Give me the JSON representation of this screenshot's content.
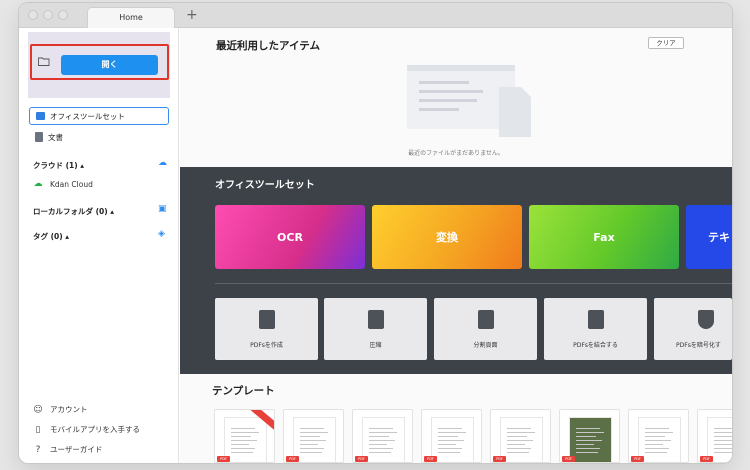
{
  "tabbar": {
    "tab_label": "Home",
    "new_tab": "+"
  },
  "sidebar": {
    "open_button": "開く",
    "items": [
      {
        "label": "オフィスツールセット",
        "color": "#2f7fe0"
      },
      {
        "label": "文書",
        "color": "#6b7280"
      }
    ],
    "cloud_header": "クラウド (1) ▴",
    "cloud_item": "Kdan Cloud",
    "local_header": "ローカルフォルダ (0) ▴",
    "tags_header": "タグ (0) ▴",
    "bottom": [
      {
        "icon": "person-icon",
        "glyph": "☺",
        "label": "アカウント"
      },
      {
        "icon": "mobile-icon",
        "glyph": "▯",
        "label": "モバイルアプリを入手する"
      },
      {
        "icon": "help-icon",
        "glyph": "?",
        "label": "ユーザーガイド"
      }
    ]
  },
  "main": {
    "recent_title": "最近利用したアイテム",
    "clear_button": "クリア",
    "empty_caption": "最近のファイルがまだありません。",
    "toolset_title": "オフィスツールセット",
    "feature_cards": [
      {
        "label": "OCR",
        "bg": "#e83aa0"
      },
      {
        "label": "変換",
        "bg": "#f5a623"
      },
      {
        "label": "Fax",
        "bg": "#63c92a"
      },
      {
        "label": "テキ",
        "bg": "#2548e8"
      }
    ],
    "tools": [
      {
        "icon": "create-pdf-icon",
        "label": "PDFsを作成"
      },
      {
        "icon": "compress-icon",
        "label": "圧縮"
      },
      {
        "icon": "split-icon",
        "label": "分割頁面"
      },
      {
        "icon": "merge-icon",
        "label": "PDFsを結合する"
      },
      {
        "icon": "encrypt-icon",
        "label": "PDFsを暗号化す"
      }
    ],
    "templates_title": "テンプレート",
    "template_badge": "PDF"
  }
}
